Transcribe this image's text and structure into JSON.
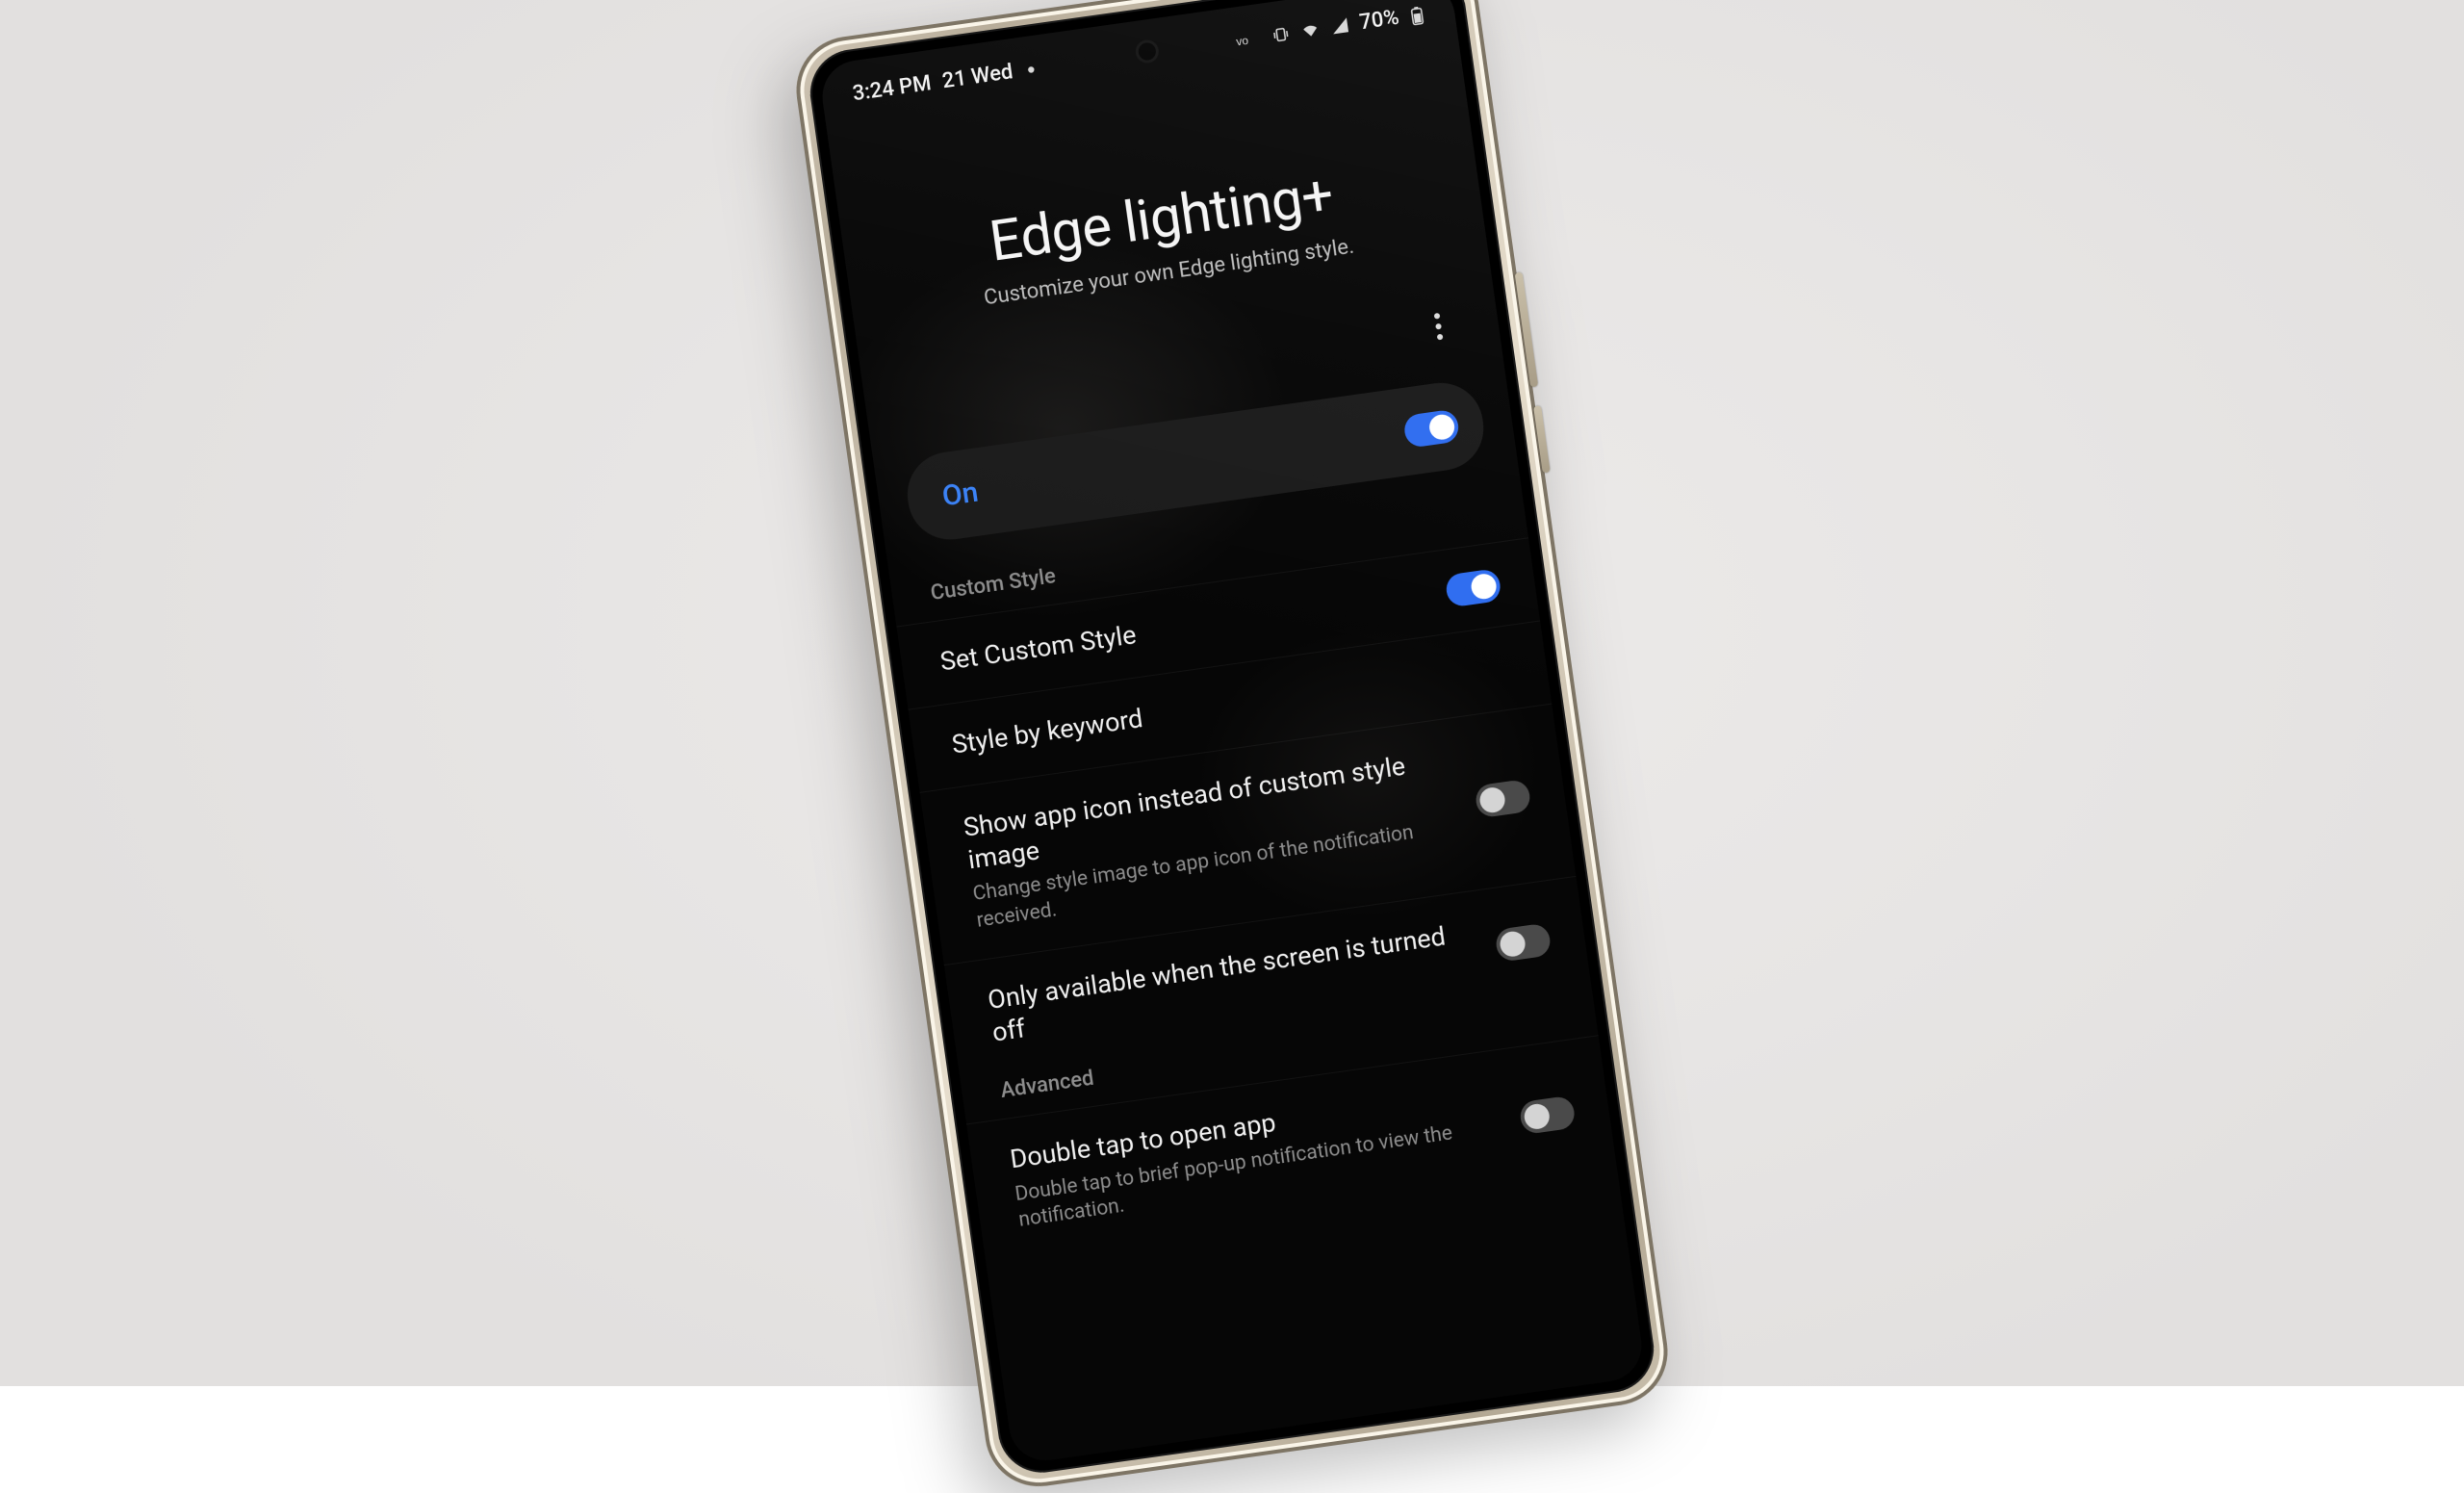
{
  "status": {
    "time": "3:24 PM",
    "date": "21 Wed",
    "battery_pct": "70%"
  },
  "header": {
    "title": "Edge lighting+",
    "subtitle": "Customize your own Edge lighting style."
  },
  "master": {
    "label": "On",
    "enabled": true
  },
  "sections": [
    {
      "label": "Custom Style",
      "rows": [
        {
          "key": "set_custom_style",
          "title": "Set Custom Style",
          "desc": null,
          "toggle": "on"
        },
        {
          "key": "style_by_keyword",
          "title": "Style by keyword",
          "desc": null,
          "toggle": null
        },
        {
          "key": "show_app_icon",
          "title": "Show app icon instead of custom style image",
          "desc": "Change style image to app icon of the notification received.",
          "toggle": "off"
        },
        {
          "key": "only_screen_off",
          "title": "Only available when the screen is turned off",
          "desc": null,
          "toggle": "off"
        }
      ]
    },
    {
      "label": "Advanced",
      "rows": [
        {
          "key": "double_tap",
          "title": "Double tap to open app",
          "desc": "Double tap to brief pop-up notification to view the notification.",
          "toggle": "off"
        }
      ]
    }
  ]
}
